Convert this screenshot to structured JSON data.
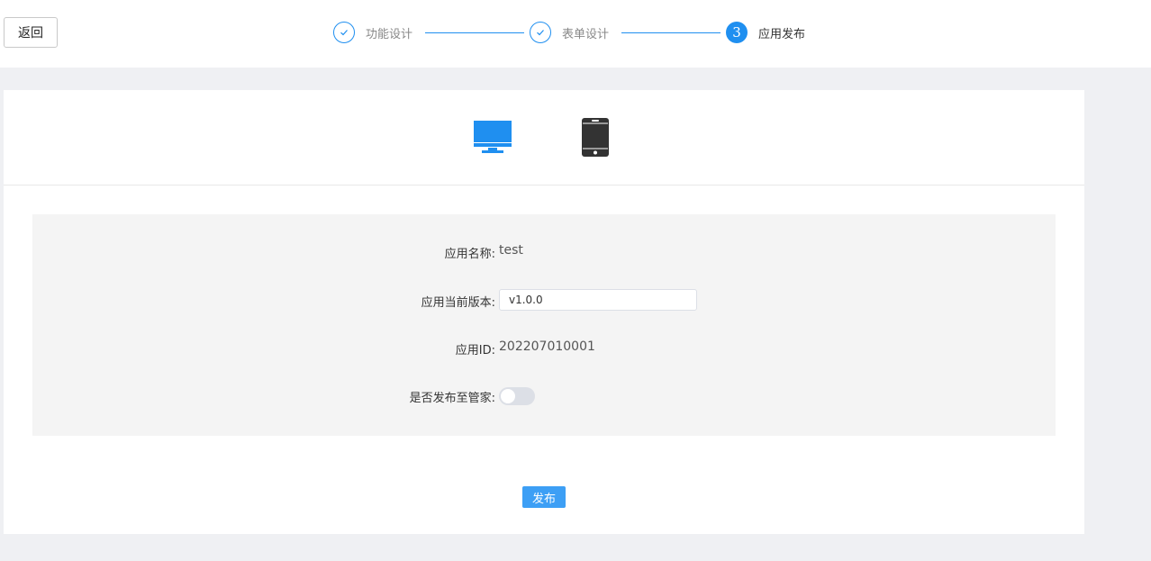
{
  "header": {
    "back_label": "返回"
  },
  "steps": [
    {
      "label": "功能设计",
      "status": "done"
    },
    {
      "label": "表单设计",
      "status": "done"
    },
    {
      "number": "3",
      "label": "应用发布",
      "status": "active"
    }
  ],
  "devices": [
    {
      "icon": "desktop-icon",
      "selected": true
    },
    {
      "icon": "mobile-icon",
      "selected": false
    }
  ],
  "form": {
    "app_name_label": "应用名称:",
    "app_name_value": "test",
    "version_label": "应用当前版本:",
    "version_value": "v1.0.0",
    "app_id_label": "应用ID:",
    "app_id_value": "202207010001",
    "publish_to_manager_label": "是否发布至管家:",
    "publish_to_manager_enabled": false
  },
  "actions": {
    "publish_label": "发布"
  },
  "colors": {
    "accent": "#1f8ff0",
    "button": "#3d9ff5",
    "page_bg": "#eff0f3",
    "panel_bg": "#f4f4f4"
  }
}
